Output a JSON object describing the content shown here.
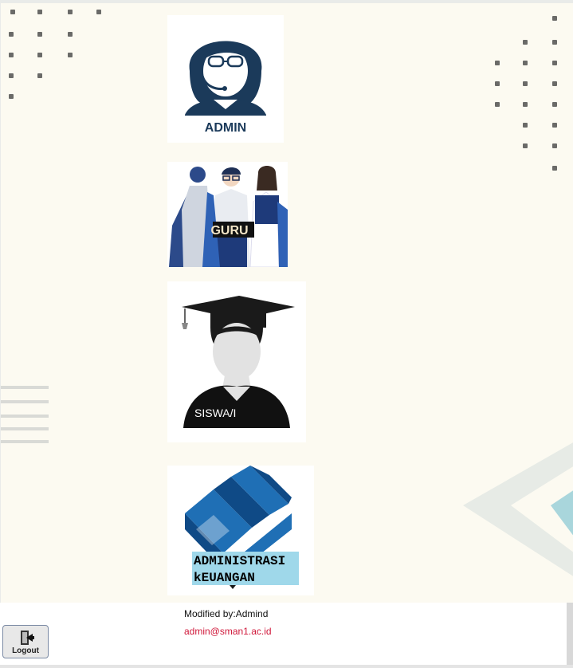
{
  "tiles": {
    "admin": {
      "label": "ADMIN"
    },
    "guru": {
      "label": "GURU"
    },
    "siswa": {
      "label": "SISWA/I"
    },
    "keuangan": {
      "line1": "ADMINISTRASI",
      "line2": "kEUANGAN"
    }
  },
  "footer": {
    "modified": "Modified by:Admind",
    "email": "admin@sman1.ac.id"
  },
  "logout": {
    "label": "Logout"
  },
  "colors": {
    "background": "#fcfaf1",
    "navy": "#1b3a5a",
    "blue": "#1f6fb5",
    "email": "#d0183a",
    "keuangan_label_bg": "#9fd8ea"
  }
}
